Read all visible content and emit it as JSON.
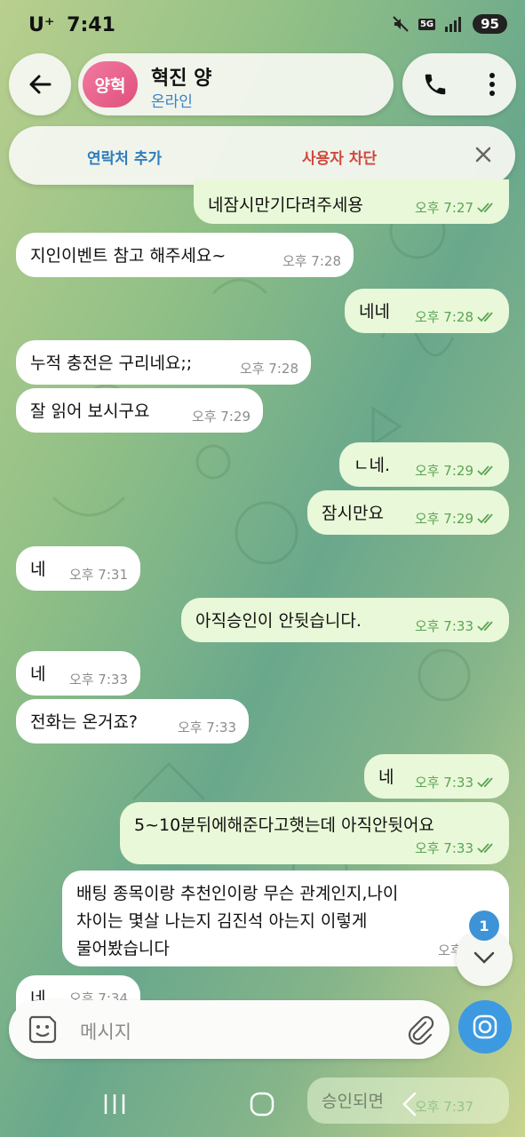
{
  "status": {
    "carrier": "U⁺",
    "time": "7:41",
    "network": "5G",
    "battery": "95"
  },
  "header": {
    "avatar_initials": "양혁",
    "name": "혁진 양",
    "status": "온라인"
  },
  "banner": {
    "add_contact": "연락처 추가",
    "block_user": "사용자 차단"
  },
  "messages": [
    {
      "dir": "out",
      "text": "네잠시만기다려주세용",
      "time": "오후 7:27"
    },
    {
      "dir": "in",
      "text": "지인이벤트 참고 해주세요~",
      "time": "오후 7:28"
    },
    {
      "dir": "out",
      "text": "네네",
      "time": "오후 7:28"
    },
    {
      "dir": "in",
      "text": "누적 충전은 구리네요;;",
      "time": "오후 7:28"
    },
    {
      "dir": "in",
      "text": "잘 읽어 보시구요",
      "time": "오후 7:29"
    },
    {
      "dir": "out",
      "text": "ㄴ네.",
      "time": "오후 7:29"
    },
    {
      "dir": "out",
      "text": "잠시만요",
      "time": "오후 7:29"
    },
    {
      "dir": "in",
      "text": "네",
      "time": "오후 7:31"
    },
    {
      "dir": "out",
      "text": "아직승인이 안뒷습니다.",
      "time": "오후 7:33"
    },
    {
      "dir": "in",
      "text": "네",
      "time": "오후 7:33"
    },
    {
      "dir": "in",
      "text": "전화는 온거죠?",
      "time": "오후 7:33"
    },
    {
      "dir": "out",
      "text": "네",
      "time": "오후 7:33"
    },
    {
      "dir": "out",
      "text": "5~10분뒤에해준다고햇는데 아직안뒷어요",
      "time": "오후 7:33"
    },
    {
      "dir": "in",
      "lines": [
        "배팅 종목이랑 추천인이랑 무슨 관계인지,나이",
        "차이는 몇살 나는지 김진석 아는지 이렇게",
        "물어봤습니다"
      ],
      "time": "오후 7:33"
    },
    {
      "dir": "in",
      "text": "네",
      "time": "오후 7:34"
    },
    {
      "dir": "out",
      "text": "승인되면",
      "time": "오후 7:37"
    }
  ],
  "unread_badge": "1",
  "input": {
    "placeholder": "메시지"
  },
  "colors": {
    "outgoing": "#e9f8d8",
    "incoming": "#ffffff",
    "accent": "#3d9ae0",
    "block_red": "#d0483d",
    "online_blue": "#3a82c4"
  },
  "icons": [
    "back-arrow-icon",
    "phone-icon",
    "more-vert-icon",
    "close-icon",
    "double-check-icon",
    "chevron-down-icon",
    "sticker-icon",
    "attach-icon",
    "camera-icon",
    "recent-apps-icon",
    "home-icon",
    "nav-back-icon"
  ]
}
